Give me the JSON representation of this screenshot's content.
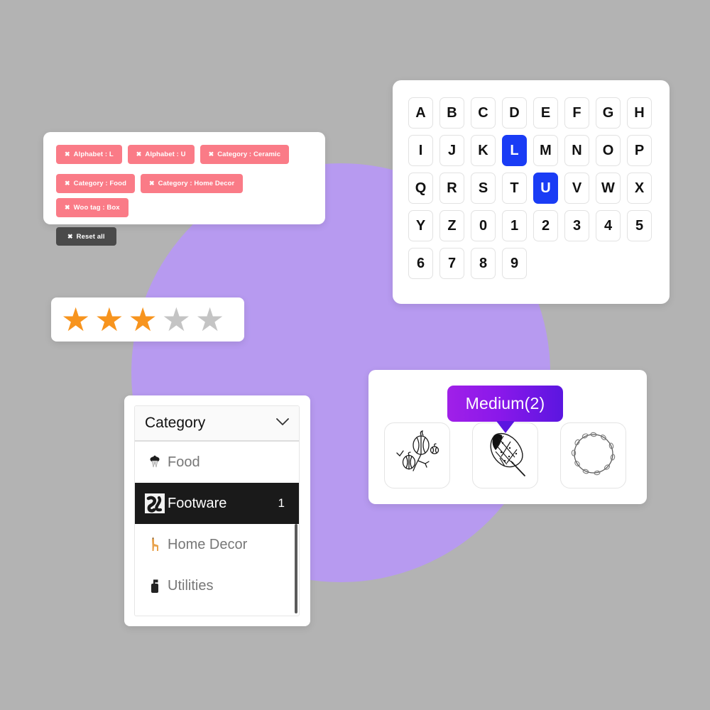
{
  "background": {
    "page_color": "#b3b3b3",
    "circle_color": "#b79af0"
  },
  "filter_chips_panel": {
    "chip_color": "#fa7b87",
    "reset_color": "#4a4a4a",
    "close_glyph": "✖",
    "chips": [
      {
        "label": "Alphabet : L"
      },
      {
        "label": "Alphabet : U"
      },
      {
        "label": "Category : Ceramic"
      },
      {
        "label": "Category : Food"
      },
      {
        "label": "Category : Home Decor"
      },
      {
        "label": "Woo tag : Box"
      }
    ],
    "reset": {
      "label": "Reset all"
    }
  },
  "alphabet_panel": {
    "selected_color": "#1a3cf5",
    "keys": [
      {
        "label": "A",
        "selected": false
      },
      {
        "label": "B",
        "selected": false
      },
      {
        "label": "C",
        "selected": false
      },
      {
        "label": "D",
        "selected": false
      },
      {
        "label": "E",
        "selected": false
      },
      {
        "label": "F",
        "selected": false
      },
      {
        "label": "G",
        "selected": false
      },
      {
        "label": "H",
        "selected": false
      },
      {
        "label": "I",
        "selected": false
      },
      {
        "label": "J",
        "selected": false
      },
      {
        "label": "K",
        "selected": false
      },
      {
        "label": "L",
        "selected": true
      },
      {
        "label": "M",
        "selected": false
      },
      {
        "label": "N",
        "selected": false
      },
      {
        "label": "O",
        "selected": false
      },
      {
        "label": "P",
        "selected": false
      },
      {
        "label": "Q",
        "selected": false
      },
      {
        "label": "R",
        "selected": false
      },
      {
        "label": "S",
        "selected": false
      },
      {
        "label": "T",
        "selected": false
      },
      {
        "label": "U",
        "selected": true
      },
      {
        "label": "V",
        "selected": false
      },
      {
        "label": "W",
        "selected": false
      },
      {
        "label": "X",
        "selected": false
      },
      {
        "label": "Y",
        "selected": false
      },
      {
        "label": "Z",
        "selected": false
      },
      {
        "label": "0",
        "selected": false
      },
      {
        "label": "1",
        "selected": false
      },
      {
        "label": "2",
        "selected": false
      },
      {
        "label": "3",
        "selected": false
      },
      {
        "label": "4",
        "selected": false
      },
      {
        "label": "5",
        "selected": false
      },
      {
        "label": "6",
        "selected": false
      },
      {
        "label": "7",
        "selected": false
      },
      {
        "label": "8",
        "selected": false
      },
      {
        "label": "9",
        "selected": false
      }
    ]
  },
  "star_rating_panel": {
    "rating": 3,
    "max": 5,
    "filled_color": "#f7941e",
    "empty_color": "#c4c4c4",
    "star_glyph": "★"
  },
  "category_panel": {
    "header": {
      "title": "Category",
      "chevron_icon": "chevron-down-icon"
    },
    "items": [
      {
        "label": "Food",
        "count": "",
        "active": false,
        "icon": "food-icon"
      },
      {
        "label": "Footware",
        "count": "1",
        "active": true,
        "icon": "footware-icon"
      },
      {
        "label": "Home Decor",
        "count": "",
        "active": false,
        "icon": "home-decor-icon"
      },
      {
        "label": "Utilities",
        "count": "",
        "active": false,
        "icon": "utilities-icon"
      }
    ]
  },
  "product_panel": {
    "tooltip": {
      "label": "Medium(2)",
      "gradient_from": "#a020e8",
      "gradient_to": "#5b16e0"
    },
    "tiles": [
      {
        "name": "gourds-sketch-thumbnail"
      },
      {
        "name": "feather-sketch-thumbnail"
      },
      {
        "name": "wreath-sketch-thumbnail"
      }
    ]
  }
}
